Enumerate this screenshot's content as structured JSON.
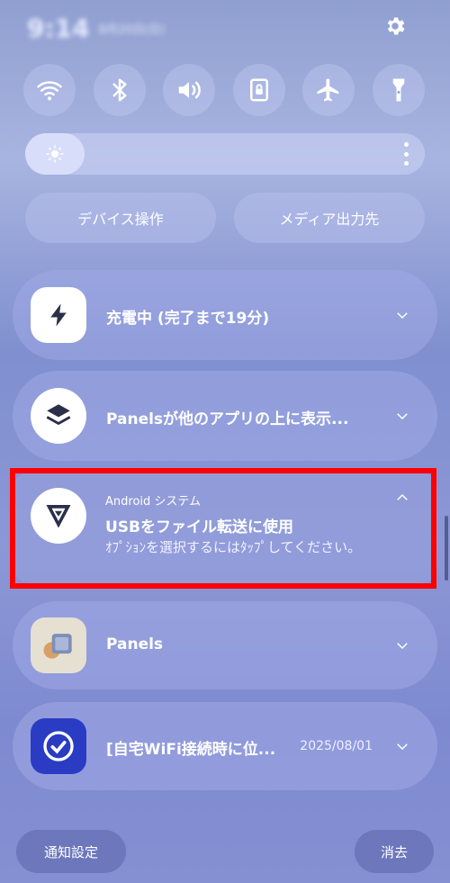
{
  "status_bar": {
    "time": "9:14",
    "date": "8月20日(日)"
  },
  "quick_settings": [
    {
      "name": "wifi-toggle",
      "icon": "wifi-icon"
    },
    {
      "name": "bluetooth-toggle",
      "icon": "bluetooth-icon"
    },
    {
      "name": "sound-toggle",
      "icon": "volume-icon"
    },
    {
      "name": "portrait-lock-toggle",
      "icon": "rotation-lock-icon"
    },
    {
      "name": "airplane-toggle",
      "icon": "airplane-icon"
    },
    {
      "name": "flashlight-toggle",
      "icon": "flashlight-icon"
    }
  ],
  "buttons": {
    "device_control": "デバイス操作",
    "media_output": "メディア出力先"
  },
  "notifications": {
    "charging": {
      "title": "充電中 (完了まで19分)"
    },
    "panels_overlay": {
      "title": "Panelsが他のアプリの上に表示..."
    },
    "android_system": {
      "app": "Android システム",
      "title": "USBをファイル転送に使用",
      "body": "ｵﾌﾟｼｮﾝを選択するにはﾀｯﾌﾟしてください。"
    },
    "panels": {
      "title": "Panels"
    },
    "wifi_reminder": {
      "title": "[自宅WiFi接続時に位...",
      "date": "2025/08/01"
    }
  },
  "footer": {
    "notification_settings": "通知設定",
    "clear": "消去"
  }
}
